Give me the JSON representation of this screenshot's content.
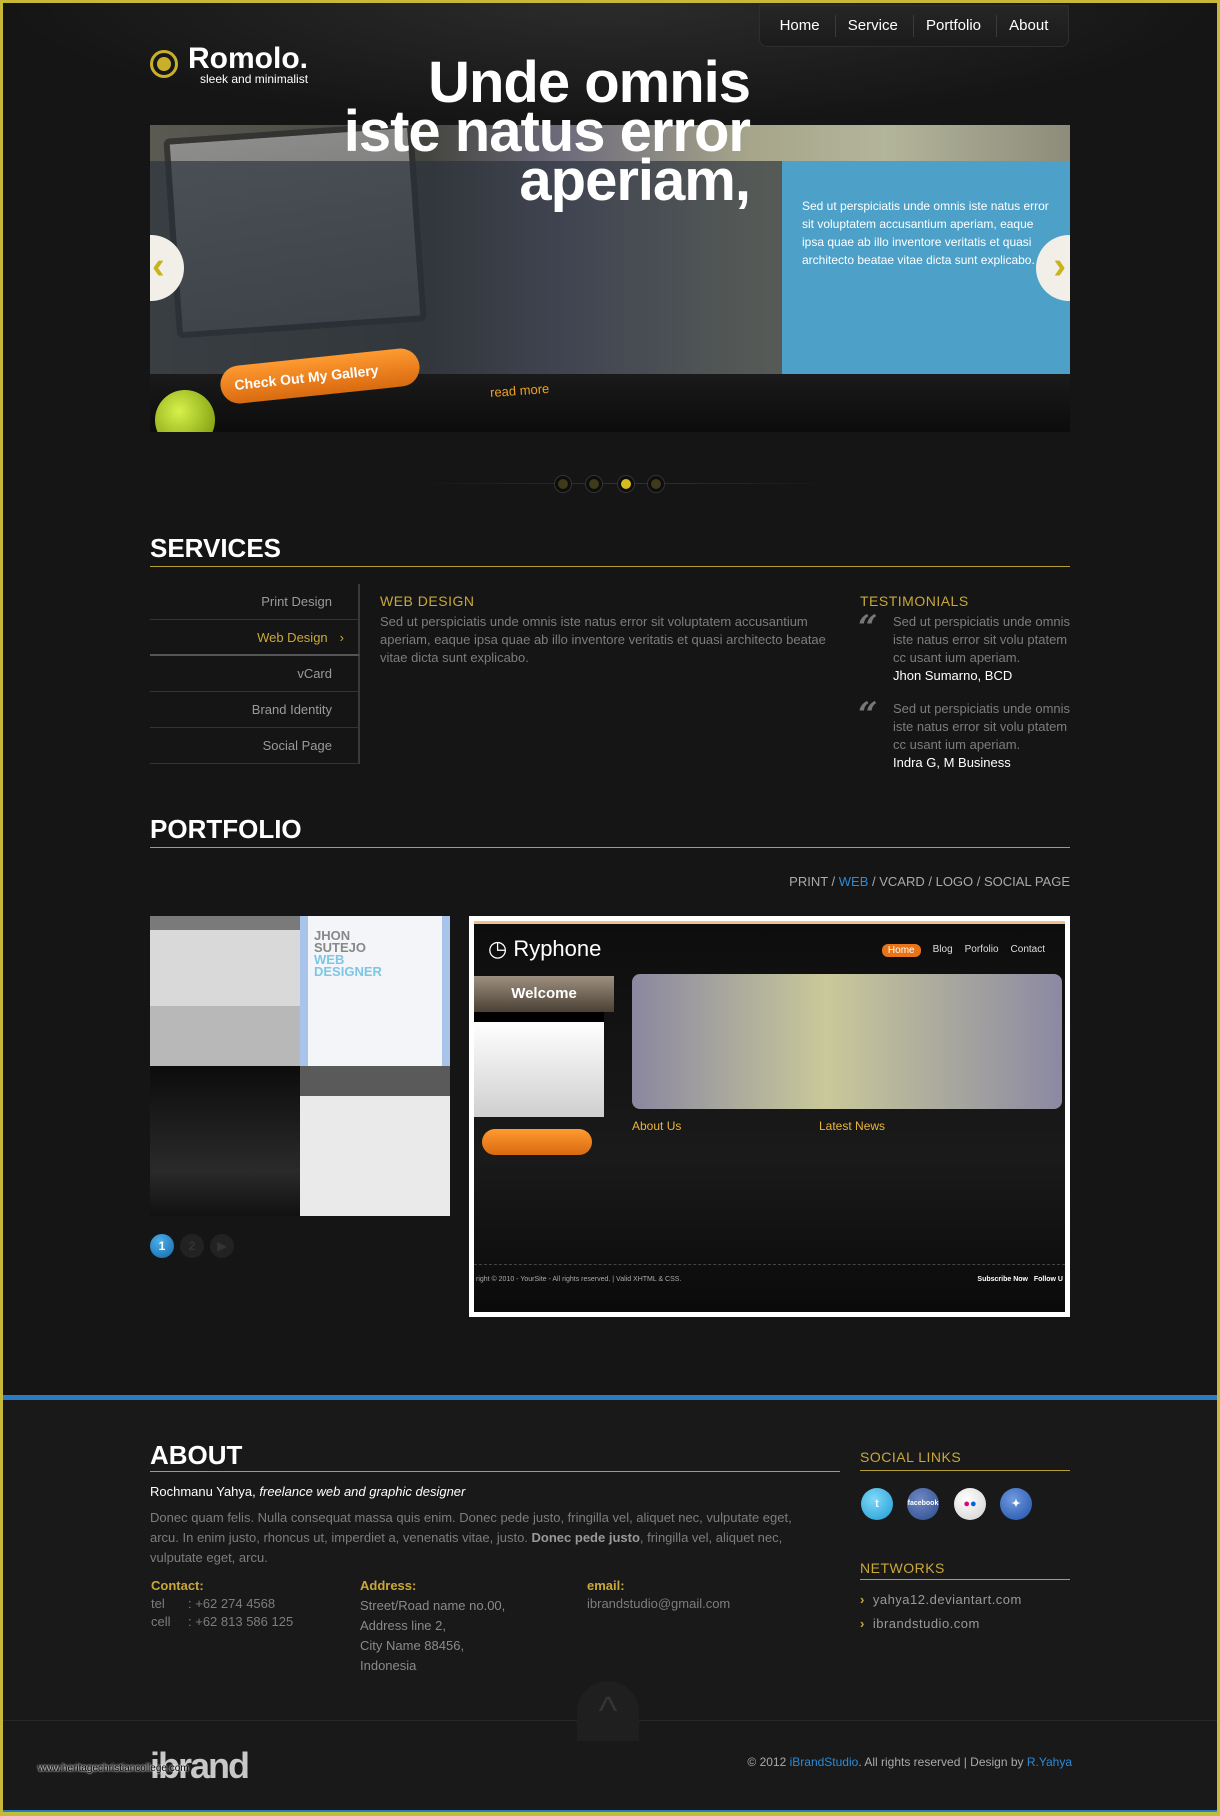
{
  "header": {
    "logo_name": "Romolo.",
    "logo_tagline": "sleek and minimalist",
    "nav": [
      "Home",
      "Service",
      "Portfolio",
      "About"
    ]
  },
  "slider": {
    "headline": [
      "Unde omnis",
      "iste natus error",
      "aperiam,"
    ],
    "description": "Sed ut perspiciatis unde omnis iste natus error sit voluptatem accusantium aperiam, eaque ipsa quae ab illo inventore veritatis et quasi architecto beatae vitae dicta sunt explicabo.",
    "image_button": "Check Out My Gallery",
    "image_read_more": "read more",
    "active_slide": 3,
    "slide_count": 4
  },
  "services": {
    "title": "SERVICES",
    "menu": [
      "Print Design",
      "Web Design",
      "vCard",
      "Brand Identity",
      "Social Page"
    ],
    "active": "Web Design",
    "content_title": "WEB DESIGN",
    "content_text": "Sed ut perspiciatis unde omnis iste natus error sit voluptatem accusantium aperiam, eaque ipsa quae ab illo inventore veritatis et quasi architecto beatae vitae dicta sunt explicabo.",
    "testimonials_title": "TESTIMONIALS",
    "testimonials": [
      {
        "text": "Sed ut perspiciatis unde omnis iste natus error sit volu ptatem cc usant ium aperiam.",
        "author": "Jhon Sumarno, BCD"
      },
      {
        "text": "Sed ut perspiciatis unde omnis iste natus error sit volu ptatem cc usant ium aperiam.",
        "author": "Indra G, M Business"
      }
    ]
  },
  "portfolio": {
    "title": "PORTFOLIO",
    "filters": [
      "PRINT",
      "WEB",
      "VCARD",
      "LOGO",
      "SOCIAL PAGE"
    ],
    "active_filter": "WEB",
    "pages": [
      "1",
      "2",
      "▶"
    ],
    "active_page": "1",
    "preview": {
      "brand": "Ryphone",
      "nav": [
        "Home",
        "Blog",
        "Porfolio",
        "Contact"
      ],
      "welcome": "Welcome",
      "about": "About Us",
      "news": "Latest News",
      "footer": "right © 2010 - YourSite - All rights reserved. | Valid XHTML & CSS.",
      "subscribe": "Subscribe Now",
      "follow": "Follow U"
    }
  },
  "about": {
    "title": "ABOUT",
    "name": "Rochmanu Yahya,",
    "role": "freelance web and graphic designer",
    "text1": "Donec quam felis. Nulla consequat massa quis enim. Donec pede justo, fringilla vel, aliquet nec, vulputate eget, arcu. In enim justo, rhoncus ut, imperdiet a, venenatis vitae, justo. ",
    "text_bold": "Donec pede justo",
    "text2": ", fringilla vel, aliquet nec, vulputate eget, arcu.",
    "contact_label": "Contact:",
    "tel_label": "tel",
    "tel": ": +62 274 4568",
    "cell_label": "cell",
    "cell": ": +62 813 586 125",
    "address_label": "Address:",
    "address": [
      "Street/Road name no.00,",
      "Address line 2,",
      "City Name 88456,",
      "Indonesia"
    ],
    "email_label": "email:",
    "email": "ibrandstudio@gmail.com"
  },
  "social": {
    "title": "SOCIAL LINKS",
    "icons": [
      "twitter-icon",
      "facebook-icon",
      "flickr-icon",
      "myspace-icon"
    ],
    "facebook_text": "facebook"
  },
  "networks": {
    "title": "NETWORKS",
    "links": [
      "yahya12.deviantart.com",
      "ibrandstudio.com"
    ]
  },
  "footer": {
    "copy_prefix": "© 2012 ",
    "studio": "iBrandStudio",
    "copy_mid": ". All rights reserved | Design by ",
    "designer": "R.Yahya",
    "brand_logo": "ibrand studio",
    "watermark": "www.heritagechristiancollege.com"
  },
  "colors": {
    "accent": "#c9a83a",
    "link": "#2c8ad6",
    "slider_box": "#4da1c9",
    "background": "#151515"
  }
}
